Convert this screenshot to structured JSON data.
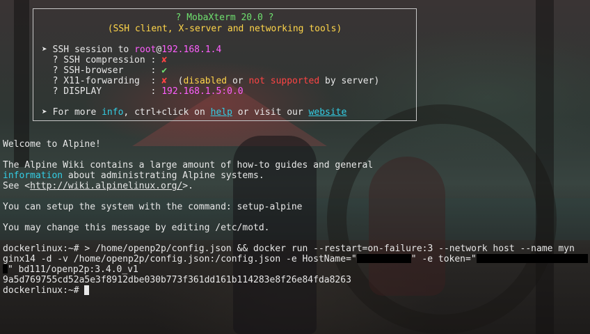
{
  "banner": {
    "title": "? MobaXterm 20.0 ?",
    "subtitle": "(SSH client, X-server and networking tools)",
    "ssh_session": {
      "arrow": "➤",
      "text": " SSH session to ",
      "user": "root",
      "at": "@",
      "host": "192.168.1.4"
    },
    "rows": [
      {
        "label": "  ? SSH compression : ",
        "value": "✘"
      },
      {
        "label": "  ? SSH-browser     : ",
        "value": "✔"
      },
      {
        "label": "  ? X11-forwarding  : ",
        "value": "✘"
      },
      {
        "label": "  ? DISPLAY         : ",
        "value": "192.168.1.5:0.0"
      }
    ],
    "x11_note": {
      "open": "  (",
      "disabled": "disabled",
      "or": " or ",
      "not_supported": "not supported",
      "by_server": " by server)"
    },
    "footer": {
      "arrow": "➤",
      "t1": " For more ",
      "info": "info",
      "t2": ", ctrl+click on ",
      "help": "help",
      "t3": " or visit our ",
      "website": "website"
    }
  },
  "motd": {
    "welcome": "Welcome to Alpine!",
    "wiki1": "The Alpine Wiki contains a large amount of how-to guides and general",
    "wiki2_link": "information",
    "wiki2_rest": " about administrating Alpine systems.",
    "see_prefix": "See <",
    "see_url": "http://wiki.alpinelinux.org/",
    "see_suffix": ">.",
    "setup": "You can setup the system with the command: setup-alpine",
    "change": "You may change this message by editing /etc/motd."
  },
  "session": {
    "cmd_line1": "dockerlinux:~# > /home/openp2p/config.json && docker run --restart=on-failure:3 --network host --name myn",
    "cmd_line2a": "ginx14 -d -v /home/openp2p/config.json:/config.json -e HostName=\"",
    "cmd_line2b": "\" -e token=\"",
    "cmd_line3": "\" bd111/openp2p:3.4.0_v1",
    "container_id": "9a5d769755cd52a5e3f8912dbe030b773f361dd161b114283e8f26e84fda8263",
    "prompt": "dockerlinux:~# "
  },
  "colors": {
    "accent_green": "#6fe06f",
    "accent_yellow": "#ffd54a",
    "accent_magenta": "#ff5fff",
    "accent_red": "#ff4444",
    "accent_cyan": "#33cfe6"
  }
}
